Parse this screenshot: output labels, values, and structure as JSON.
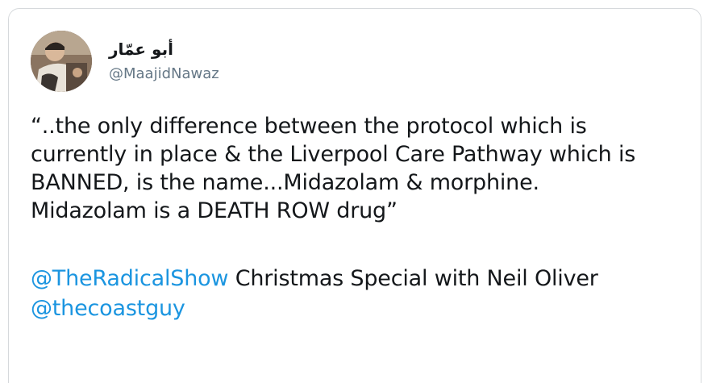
{
  "tweet": {
    "author": {
      "display_name": "أبو عمّار",
      "handle": "@MaajidNawaz",
      "avatar_icon": "profile-photo"
    },
    "quote_text": "“..the only difference between the protocol which is\ncurrently in place & the Liverpool Care Pathway which is\nBANNED, is the name...Midazolam & morphine.\nMidazolam is a DEATH ROW drug”",
    "mention_1": "@TheRadicalShow",
    "footer_text": " Christmas Special with Neil Oliver",
    "mention_2": "@thecoastguy"
  },
  "colors": {
    "text": "#14171a",
    "secondary": "#657786",
    "link": "#1b95e0",
    "border": "#d6d9dc"
  }
}
